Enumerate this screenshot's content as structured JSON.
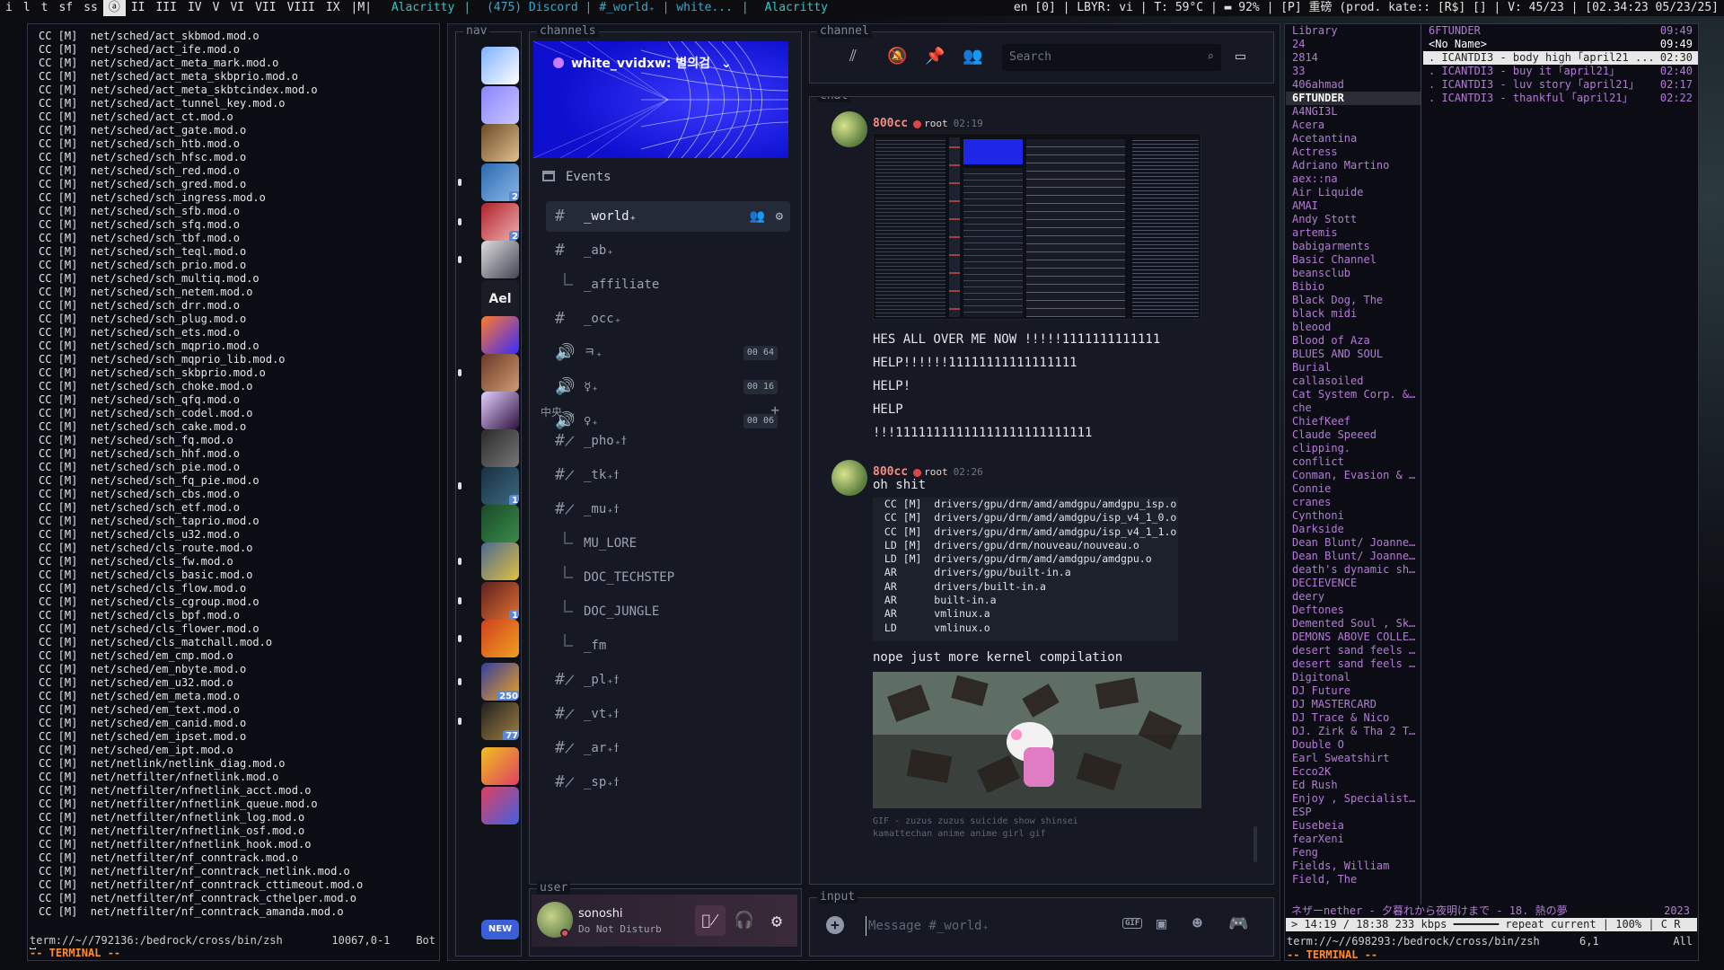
{
  "topbar": {
    "workspaces": [
      "i",
      "l",
      "t",
      "sf",
      "ss",
      "ⓐ",
      "II",
      "III",
      "IV",
      "V",
      "VI",
      "VII",
      "VIII",
      "IX",
      "|M|"
    ],
    "active_ws": "ⓐ",
    "left_title": "Alacritty",
    "middle_title": "(475) Discord | #_world₊ | white...",
    "right_title": "Alacritty",
    "status": "en  [0] | LBYR: vi | T: 59°C | ▬ 92% | [P] 重磅 (prod. kate:: [R$] [] | V: 45/23 | [02.34:23 05/23/25]"
  },
  "left_terminal": {
    "lines": [
      "CC [M]  net/sched/act_skbmod.mod.o",
      "CC [M]  net/sched/act_ife.mod.o",
      "CC [M]  net/sched/act_meta_mark.mod.o",
      "CC [M]  net/sched/act_meta_skbprio.mod.o",
      "CC [M]  net/sched/act_meta_skbtcindex.mod.o",
      "CC [M]  net/sched/act_tunnel_key.mod.o",
      "CC [M]  net/sched/act_ct.mod.o",
      "CC [M]  net/sched/act_gate.mod.o",
      "CC [M]  net/sched/sch_htb.mod.o",
      "CC [M]  net/sched/sch_hfsc.mod.o",
      "CC [M]  net/sched/sch_red.mod.o",
      "CC [M]  net/sched/sch_gred.mod.o",
      "CC [M]  net/sched/sch_ingress.mod.o",
      "CC [M]  net/sched/sch_sfb.mod.o",
      "CC [M]  net/sched/sch_sfq.mod.o",
      "CC [M]  net/sched/sch_tbf.mod.o",
      "CC [M]  net/sched/sch_teql.mod.o",
      "CC [M]  net/sched/sch_prio.mod.o",
      "CC [M]  net/sched/sch_multiq.mod.o",
      "CC [M]  net/sched/sch_netem.mod.o",
      "CC [M]  net/sched/sch_drr.mod.o",
      "CC [M]  net/sched/sch_plug.mod.o",
      "CC [M]  net/sched/sch_ets.mod.o",
      "CC [M]  net/sched/sch_mqprio.mod.o",
      "CC [M]  net/sched/sch_mqprio_lib.mod.o",
      "CC [M]  net/sched/sch_skbprio.mod.o",
      "CC [M]  net/sched/sch_choke.mod.o",
      "CC [M]  net/sched/sch_qfq.mod.o",
      "CC [M]  net/sched/sch_codel.mod.o",
      "CC [M]  net/sched/sch_cake.mod.o",
      "CC [M]  net/sched/sch_fq.mod.o",
      "CC [M]  net/sched/sch_hhf.mod.o",
      "CC [M]  net/sched/sch_pie.mod.o",
      "CC [M]  net/sched/sch_fq_pie.mod.o",
      "CC [M]  net/sched/sch_cbs.mod.o",
      "CC [M]  net/sched/sch_etf.mod.o",
      "CC [M]  net/sched/sch_taprio.mod.o",
      "CC [M]  net/sched/cls_u32.mod.o",
      "CC [M]  net/sched/cls_route.mod.o",
      "CC [M]  net/sched/cls_fw.mod.o",
      "CC [M]  net/sched/cls_basic.mod.o",
      "CC [M]  net/sched/cls_flow.mod.o",
      "CC [M]  net/sched/cls_cgroup.mod.o",
      "CC [M]  net/sched/cls_bpf.mod.o",
      "CC [M]  net/sched/cls_flower.mod.o",
      "CC [M]  net/sched/cls_matchall.mod.o",
      "CC [M]  net/sched/em_cmp.mod.o",
      "CC [M]  net/sched/em_nbyte.mod.o",
      "CC [M]  net/sched/em_u32.mod.o",
      "CC [M]  net/sched/em_meta.mod.o",
      "CC [M]  net/sched/em_text.mod.o",
      "CC [M]  net/sched/em_canid.mod.o",
      "CC [M]  net/sched/em_ipset.mod.o",
      "CC [M]  net/sched/em_ipt.mod.o",
      "CC [M]  net/netlink/netlink_diag.mod.o",
      "CC [M]  net/netfilter/nfnetlink.mod.o",
      "CC [M]  net/netfilter/nfnetlink_acct.mod.o",
      "CC [M]  net/netfilter/nfnetlink_queue.mod.o",
      "CC [M]  net/netfilter/nfnetlink_log.mod.o",
      "CC [M]  net/netfilter/nfnetlink_osf.mod.o",
      "CC [M]  net/netfilter/nfnetlink_hook.mod.o",
      "CC [M]  net/netfilter/nf_conntrack.mod.o",
      "CC [M]  net/netfilter/nf_conntrack_netlink.mod.o",
      "CC [M]  net/netfilter/nf_conntrack_cttimeout.mod.o",
      "CC [M]  net/netfilter/nf_conntrack_cthelper.mod.o",
      "CC [M]  net/netfilter/nf_conntrack_amanda.mod.o"
    ],
    "status_left": "term://~//792136:/bedrock/cross/bin/zsh",
    "status_mid": "10067,0-1",
    "status_right": "Bot",
    "mode": "-- TERMINAL --"
  },
  "discord": {
    "labels": {
      "nav": "nav",
      "channels": "channels",
      "channel": "channel",
      "chat": "chat",
      "user": "user",
      "input": "input"
    },
    "server": {
      "name": "white_vvidxw: 별의검"
    },
    "events": "Events",
    "channels": [
      {
        "name": "_world₊",
        "icon": "#",
        "selected": true
      },
      {
        "name": "_ab₊",
        "icon": "#"
      },
      {
        "name": "_affiliate",
        "icon": "thread"
      },
      {
        "name": "_occ₊",
        "icon": "#"
      },
      {
        "name": "ㅋ₊",
        "icon": "voice",
        "count": "00 64"
      },
      {
        "name": "☿₊",
        "icon": "voice",
        "count": "00 16"
      },
      {
        "name": "♀₊",
        "icon": "voice",
        "count": "00 06"
      }
    ],
    "category": "中央",
    "channels2": [
      {
        "name": "_pho₊ϯ",
        "icon": "#*"
      },
      {
        "name": "_tk₊ϯ",
        "icon": "#*"
      },
      {
        "name": "_mu₊ϯ",
        "icon": "#*"
      },
      {
        "name": "MU_LORE",
        "icon": "thread"
      },
      {
        "name": "DOC_TECHSTEP",
        "icon": "thread"
      },
      {
        "name": "DOC_JUNGLE",
        "icon": "thread"
      },
      {
        "name": "_fm",
        "icon": "thread"
      },
      {
        "name": "_pl₊ϯ",
        "icon": "#*"
      },
      {
        "name": "_vt₊ϯ",
        "icon": "#*"
      },
      {
        "name": "_ar₊ϯ",
        "icon": "#*"
      },
      {
        "name": "_sp₊ϯ",
        "icon": "#*"
      }
    ],
    "guild_badges": [
      "",
      "",
      "",
      "2",
      "2",
      "",
      "",
      "",
      "",
      "",
      "",
      "1",
      "",
      "",
      "1",
      "",
      "250",
      "77",
      "",
      "",
      "NEW"
    ],
    "guild_text": "Ael",
    "search_placeholder": "Search",
    "messages": [
      {
        "user": "800cc",
        "role": "root",
        "time": "02:19",
        "lines": [
          "HES ALL OVER ME NOW !!!!!1111111111111",
          "HELP!!!!!!11111111111111111",
          "HELP!",
          "HELP",
          "!!!11111111111111111111111111"
        ]
      },
      {
        "user": "800cc",
        "role": "root",
        "time": "02:26",
        "text": "oh shit",
        "code": [
          " CC [M]  drivers/gpu/drm/amd/amdgpu/amdgpu_isp.o",
          " CC [M]  drivers/gpu/drm/amd/amdgpu/isp_v4_1_0.o",
          " CC [M]  drivers/gpu/drm/amd/amdgpu/isp_v4_1_1.o",
          " LD [M]  drivers/gpu/drm/nouveau/nouveau.o",
          " LD [M]  drivers/gpu/drm/amd/amdgpu/amdgpu.o",
          " AR      drivers/gpu/built-in.a",
          " AR      drivers/built-in.a",
          " AR      built-in.a",
          " AR      vmlinux.a",
          " LD      vmlinux.o"
        ],
        "after": "nope just more kernel compilation",
        "caption": "GIF - zuzus zuzus suicide show shinsei kamattechan anime anime girl gif"
      }
    ],
    "user": {
      "name": "sonoshi",
      "status": "Do Not Disturb"
    },
    "input_placeholder": "Message #_world₊"
  },
  "music": {
    "library_title": "Library",
    "library": [
      "24",
      "2814",
      "33",
      "406ahmad",
      "6FTUNDER",
      "A4NGI3L",
      "Acera",
      "Acetantina",
      "Actress",
      "Adriano Martino",
      "aex::na",
      "Air Liquide",
      "AMAI",
      "Andy Stott",
      "artemis",
      "babigarments",
      "Basic Channel",
      "beansclub",
      "Bibio",
      "Black Dog, The",
      "black midi",
      "bleood",
      "Blood of Aza",
      "BLUES AND SOUL",
      "Burial",
      "callasoiled",
      "Cat System Corp. & ...",
      "che",
      "ChiefKeef",
      "Claude Speeed",
      "clipping.",
      "conflict",
      "Conman, Evasion & M...",
      "Connie",
      "cranes",
      "Cynthoni",
      "Darkside",
      "Dean Blunt/ Joanne ...",
      "Dean Blunt/ Joanne ...",
      "death's dynamic shr...",
      "DECIEVENCE",
      "deery",
      "Deftones",
      "Demented Soul , Ski...",
      "DEMONS ABOVE COLLEC...",
      "desert sand feels w...",
      "desert sand feels w...",
      "Digitonal",
      "DJ Future",
      "DJ MASTERCARD",
      "DJ Trace & Nico",
      "DJ. Zirk & Tha 2 Th...",
      "Double O",
      "Earl Sweatshirt",
      "Ecco2K",
      "Ed Rush",
      "Enjoy , Specialist X",
      "ESP",
      "Eusebeia",
      "fearXeni",
      "Feng",
      "Fields, William",
      "Field, The"
    ],
    "library_selected": "6FTUNDER",
    "pl_title": "6FTUNDER",
    "pl_title_time": "09:49",
    "pl_sub": "<No Name>",
    "pl_sub_time": "09:49",
    "tracks": [
      {
        "t": ". ICANTDI3 - body high ｢april21 ...",
        "d": "02:30",
        "sel": true
      },
      {
        "t": ". ICANTDI3 - buy it ｢april21｣",
        "d": "02:40"
      },
      {
        "t": ". ICANTDI3 - luv story ｢april21｣",
        "d": "02:17"
      },
      {
        "t": ". ICANTDI3 - thankful ｢april21｣",
        "d": "02:22"
      }
    ],
    "now": "ネザーnether - 夕暮れから夜明けまで - 18. 熱の夢",
    "year": "2023",
    "progress": "> 14:19 / 18:38  233 kbps ━━━━━━━  repeat current | 100% | C R",
    "status_left": "term://~//698293:/bedrock/cross/bin/zsh",
    "status_mid": "6,1",
    "status_right": "All",
    "mode": "-- TERMINAL --"
  },
  "colors": {
    "accent": "#5865f2",
    "server_banner": "#1a1aff",
    "name": "#f88c7c",
    "lib": "#b47bd6",
    "mode": "#ff8c2a"
  }
}
